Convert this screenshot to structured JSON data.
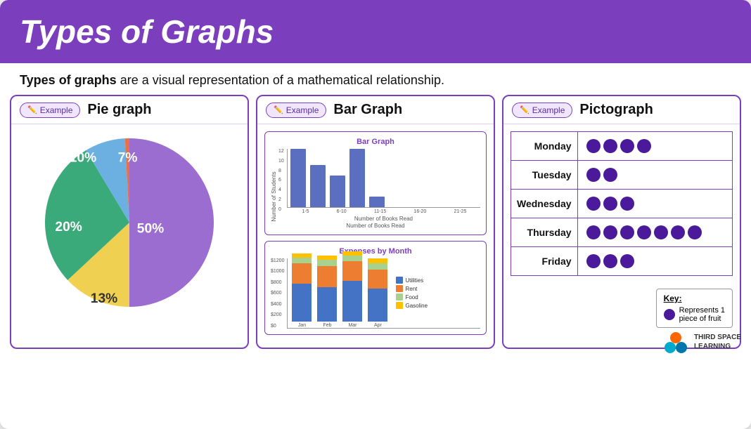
{
  "header": {
    "title": "Types of Graphs",
    "bg_color": "#7B3FBE"
  },
  "subtitle": {
    "bold_text": "Types of graphs",
    "rest_text": " are a visual representation of a mathematical relationship."
  },
  "panels": {
    "pie": {
      "example_label": "Example",
      "title": "Pie graph",
      "slices": [
        {
          "label": "50%",
          "color": "#9B6DD1",
          "value": 50
        },
        {
          "label": "13%",
          "color": "#F0D050",
          "value": 13
        },
        {
          "label": "20%",
          "color": "#3BAA7A",
          "value": 20
        },
        {
          "label": "10%",
          "color": "#6BB0E0",
          "value": 10
        },
        {
          "label": "7%",
          "color": "#E8704A",
          "value": 7
        }
      ]
    },
    "bar": {
      "example_label": "Example",
      "title": "Bar Graph",
      "chart1": {
        "title": "Bar Graph",
        "y_label": "Number of Students",
        "x_label": "Number of Books Read",
        "y_ticks": [
          "12",
          "10",
          "8",
          "6",
          "4",
          "2",
          "0"
        ],
        "bars": [
          {
            "label": "1-5",
            "height": 11,
            "max": 12
          },
          {
            "label": "6-10",
            "height": 8,
            "max": 12
          },
          {
            "label": "11-15",
            "height": 6,
            "max": 12
          },
          {
            "label": "16-20",
            "height": 11,
            "max": 12
          },
          {
            "label": "21-25",
            "height": 2,
            "max": 12
          }
        ],
        "bar_color": "#5a6fc0"
      },
      "chart2": {
        "title": "Expenses by Month",
        "y_ticks": [
          "$1200",
          "$1000",
          "$800",
          "$600",
          "$400",
          "$200",
          "$0"
        ],
        "x_label": "",
        "months": [
          "Jan",
          "Feb",
          "Mar",
          "Apr"
        ],
        "legend": [
          {
            "label": "Utilities",
            "color": "#4472C4"
          },
          {
            "label": "Rent",
            "color": "#ED7D31"
          },
          {
            "label": "Food",
            "color": "#A9D18E"
          },
          {
            "label": "Gasoline",
            "color": "#FFC000"
          }
        ],
        "data": [
          {
            "month": "Jan",
            "utilities": 55,
            "rent": 30,
            "food": 8,
            "gasoline": 4
          },
          {
            "month": "Feb",
            "utilities": 52,
            "rent": 30,
            "food": 8,
            "gasoline": 4
          },
          {
            "month": "Mar",
            "utilities": 68,
            "rent": 30,
            "food": 8,
            "gasoline": 4
          },
          {
            "month": "Apr",
            "utilities": 52,
            "rent": 30,
            "food": 8,
            "gasoline": 4
          }
        ]
      }
    },
    "picto": {
      "example_label": "Example",
      "title": "Pictograph",
      "rows": [
        {
          "day": "Monday",
          "dots": 4
        },
        {
          "day": "Tuesday",
          "dots": 2
        },
        {
          "day": "Wednesday",
          "dots": 3
        },
        {
          "day": "Thursday",
          "dots": 7
        },
        {
          "day": "Friday",
          "dots": 3
        }
      ],
      "key_title": "Key:",
      "key_text": "Represents 1\npiece of fruit"
    }
  },
  "logo": {
    "line1": "THIRD SPACE",
    "line2": "LEARNING"
  }
}
